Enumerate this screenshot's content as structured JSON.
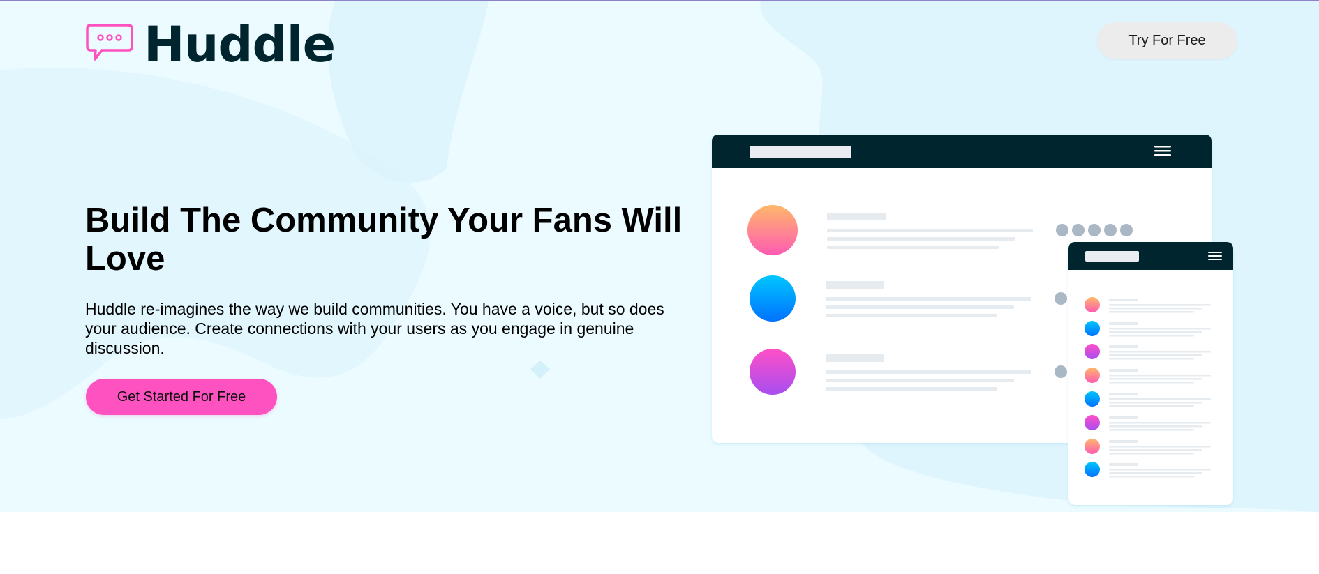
{
  "brand": {
    "name": "Huddle",
    "logo_icon": "speech-bubble-icon",
    "colors": {
      "accent_pink": "#ff52c1",
      "dark_navy": "#00252e",
      "hero_background": "#ebfbff",
      "button_gray": "#ececec"
    }
  },
  "header": {
    "cta_label": "Try For Free"
  },
  "hero": {
    "headline": "Build The Community Your Fans Will Love",
    "description": "Huddle re-imagines the way we build communities. You have a voice, but so does your audience. Create connections with your users as you engage in genuine discussion.",
    "cta_label": "Get Started For Free"
  },
  "mockup": {
    "desktop_rows": [
      {
        "avatar_gradient": [
          "#ffb86a",
          "#ff5bb2"
        ],
        "status_dots": 5
      },
      {
        "avatar_gradient": [
          "#00c6ff",
          "#0072ff"
        ],
        "status_dots": 1
      },
      {
        "avatar_gradient": [
          "#ff4fc7",
          "#a74ef0"
        ],
        "status_dots": 1
      }
    ],
    "mobile_rows": [
      {
        "avatar_gradient": [
          "#ffb86a",
          "#ff5bb2"
        ]
      },
      {
        "avatar_gradient": [
          "#00c6ff",
          "#0072ff"
        ]
      },
      {
        "avatar_gradient": [
          "#ff4fc7",
          "#a74ef0"
        ]
      },
      {
        "avatar_gradient": [
          "#ffb86a",
          "#ff5bb2"
        ]
      },
      {
        "avatar_gradient": [
          "#00c6ff",
          "#0072ff"
        ]
      },
      {
        "avatar_gradient": [
          "#ff4fc7",
          "#a74ef0"
        ]
      },
      {
        "avatar_gradient": [
          "#ffb86a",
          "#ff5bb2"
        ]
      },
      {
        "avatar_gradient": [
          "#00c6ff",
          "#0072ff"
        ]
      }
    ]
  }
}
